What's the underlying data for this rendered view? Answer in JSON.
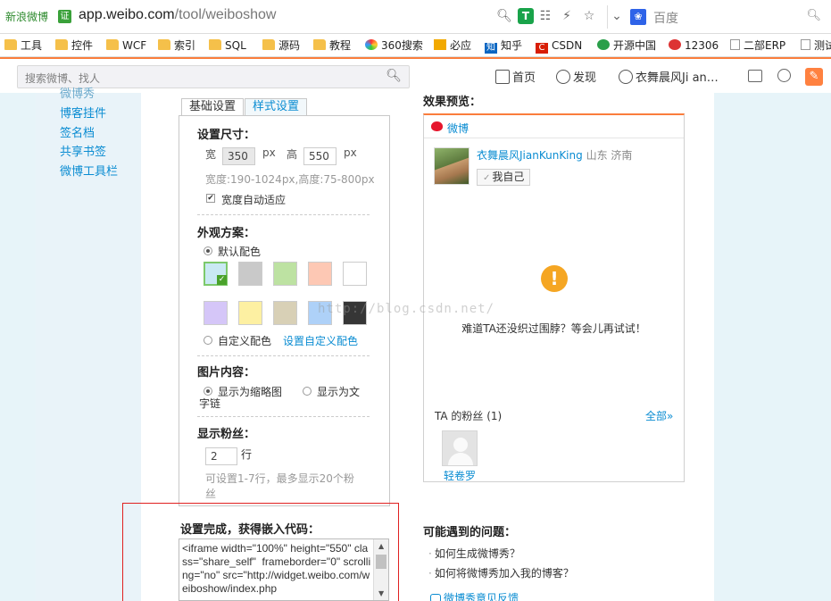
{
  "browser": {
    "site_badge": "新浪微博",
    "verified_icon": "证",
    "url_host": "app.weibo.com",
    "url_path": "/tool/weiboshow",
    "search_engine_label": "百度"
  },
  "bookmarks": [
    "工具",
    "控件",
    "WCF",
    "索引",
    "SQL",
    "源码",
    "教程",
    "360搜索",
    "必应",
    "知乎",
    "CSDN",
    "开源中国",
    "12306",
    "二部ERP",
    "测试"
  ],
  "weibo_nav": {
    "search_placeholder": "搜索微博、找人",
    "home": "首页",
    "discover": "发现",
    "username": "衣舞晨风Ji an…",
    "accent_color": "#fa7d3c"
  },
  "left_nav": {
    "items": [
      "微博秀",
      "博客挂件",
      "签名档",
      "共享书签",
      "微博工具栏"
    ]
  },
  "tabs": [
    "基础设置",
    "样式设置"
  ],
  "settings": {
    "size": {
      "title": "设置尺寸：",
      "width_label": "宽",
      "width_value": "350",
      "height_label": "高",
      "height_value": "550",
      "unit": "px",
      "range_hint": "宽度:190-1024px,高度:75-800px",
      "auto_width_label": "宽度自动适应"
    },
    "appearance": {
      "title": "外观方案：",
      "default_label": "默认配色",
      "custom_label": "自定义配色",
      "custom_link": "设置自定义配色",
      "swatches": [
        "#c9e9f3",
        "#c9c9c9",
        "#bde2a2",
        "#fdc8b4",
        "#ffffff",
        "#d5c6f8",
        "#fdf0a2",
        "#d8d0b6",
        "#aed1f8",
        "#363636"
      ]
    },
    "image": {
      "title": "图片内容：",
      "thumb_label": "显示为缩略图",
      "text_label": "显示为文",
      "text_label_cont": "字链"
    },
    "fans": {
      "title": "显示粉丝：",
      "count_value": "2",
      "unit": "行",
      "hint_line1": "可设置1-7行，最多显示20个粉",
      "hint_line2": "丝"
    }
  },
  "embed": {
    "title": "设置完成，获得嵌入代码：",
    "code": "<iframe width=\"100%\" height=\"550\" class=\"share_self\"  frameborder=\"0\" scrolling=\"no\" src=\"http://widget.weibo.com/weiboshow/index.php"
  },
  "preview": {
    "title": "效果预览：",
    "logo_text": "微博",
    "user_name": "衣舞晨风JianKunKing",
    "user_location": "山东 济南",
    "self_button": "我自己",
    "empty_message": "难道TA还没织过围脖？等会儿再试试！",
    "fans_label": "TA 的粉丝 (1)",
    "fans_all": "全部»",
    "fan_name": "轻卷罗"
  },
  "problems": {
    "title": "可能遇到的问题：",
    "items": [
      "如何生成微博秀？",
      "如何将微博秀加入我的博客？"
    ],
    "feedback": "微博秀意见反馈"
  },
  "watermark": "http://blog.csdn.net/"
}
